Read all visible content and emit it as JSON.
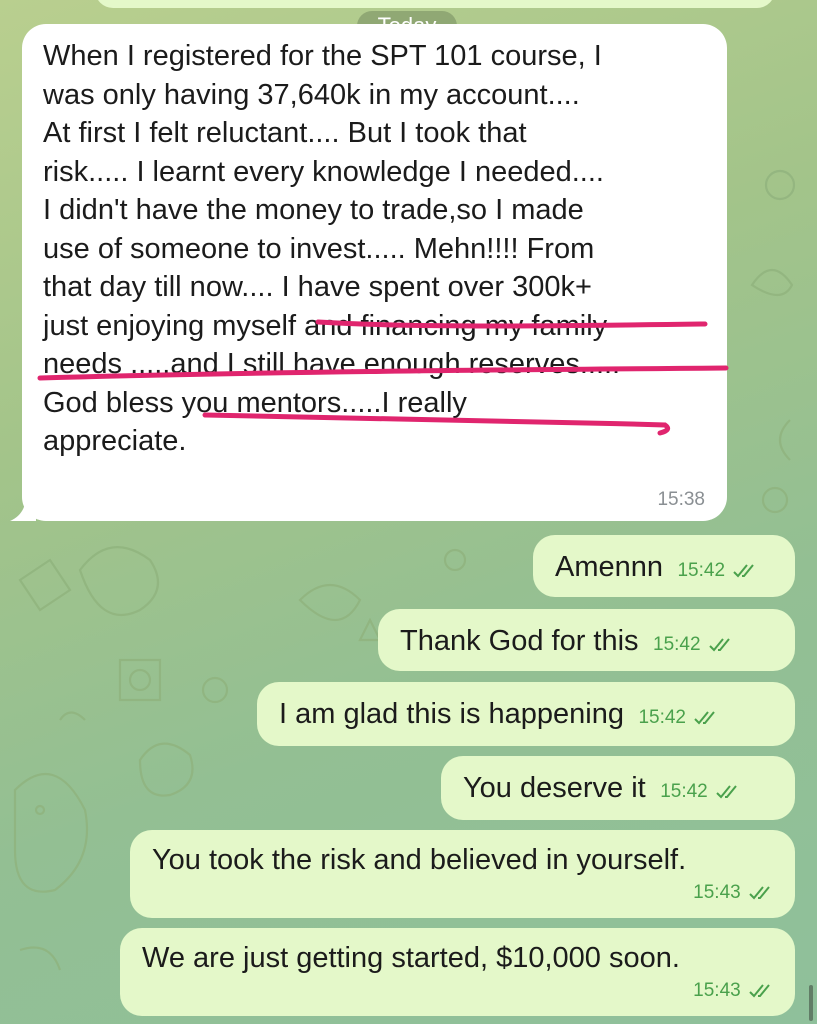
{
  "chat": {
    "date_label": "Today",
    "incoming": {
      "text": "When I registered for the SPT 101 course, I\nwas only having 37,640k in my account....\nAt first I felt reluctant.... But I took that\nrisk..... I learnt every knowledge I needed....\nI didn't have the money to trade,so I made\nuse of someone to invest..... Mehn!!!! From\nthat day till now.... I have spent over 300k+\njust enjoying myself and financing my family\nneeds .....and I still have enough reserves.....\nGod bless you mentors.....I really\nappreciate.",
      "time": "15:38"
    },
    "outgoing": [
      {
        "text": "Amennn",
        "time": "15:42"
      },
      {
        "text": "Thank God for this",
        "time": "15:42"
      },
      {
        "text": "I am glad this is happening",
        "time": "15:42"
      },
      {
        "text": "You deserve it",
        "time": "15:42"
      },
      {
        "text": "You took the risk and believed in yourself.",
        "time": "15:43"
      },
      {
        "text": "We are just getting started, $10,000 soon.",
        "time": "15:43"
      }
    ],
    "colors": {
      "incoming_bubble": "#ffffff",
      "outgoing_bubble": "#e4f8c9",
      "read_check": "#4aa14c",
      "highlight_pen": "#e0256e",
      "wallpaper": "#a3c48a"
    }
  }
}
